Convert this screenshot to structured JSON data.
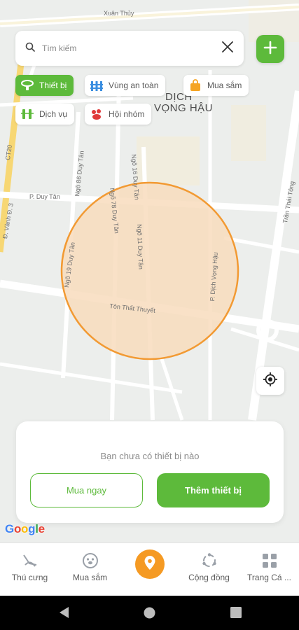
{
  "map": {
    "district_label": [
      "DỊCH",
      "VỌNG HẬU"
    ],
    "streets": {
      "xuan_thuy": "Xuân Thủy",
      "ct20": "CT20",
      "duy_tan": "P. Duy Tân",
      "ngo86": "Ngõ 86 Duy Tân",
      "ngo78": "Ngõ 78 Duy Tân",
      "ngo16": "Ngõ 16 Duy Tân",
      "ngo11": "Ngõ 11 Duy Tân",
      "ngo19": "Ngõ 19 Duy Tân",
      "dich_vong_hau": "P. Dịch Vọng Hậu",
      "ton_that_thuyet": "Tôn Thất Thuyết",
      "tran_thai_tong": "Trần Thái Tông",
      "vanh_dai3": "Đ. Vành Đ. 3"
    },
    "google_logo": [
      "G",
      "o",
      "o",
      "g",
      "l",
      "e"
    ],
    "google_colors": [
      "#4285F4",
      "#EA4335",
      "#FBBC05",
      "#4285F4",
      "#34A853",
      "#EA4335"
    ]
  },
  "search": {
    "placeholder": "Tìm kiếm"
  },
  "chips": {
    "devices": "Thiết bị",
    "safe_zone": "Vùng an toàn",
    "shopping": "Mua sắm",
    "services": "Dịch vụ",
    "groups": "Hội nhóm"
  },
  "panel": {
    "message": "Bạn chưa có thiết bị nào",
    "buy_now": "Mua ngay",
    "add_device": "Thêm thiết bị"
  },
  "nav": {
    "pets": "Thú cưng",
    "shopping": "Mua sắm",
    "community": "Cộng đồng",
    "profile": "Trang Cá ..."
  },
  "colors": {
    "accent_green": "#5dba3b",
    "accent_orange": "#f59a23",
    "zone_fill": "#f8dcbd",
    "zone_stroke": "#f29a33"
  }
}
